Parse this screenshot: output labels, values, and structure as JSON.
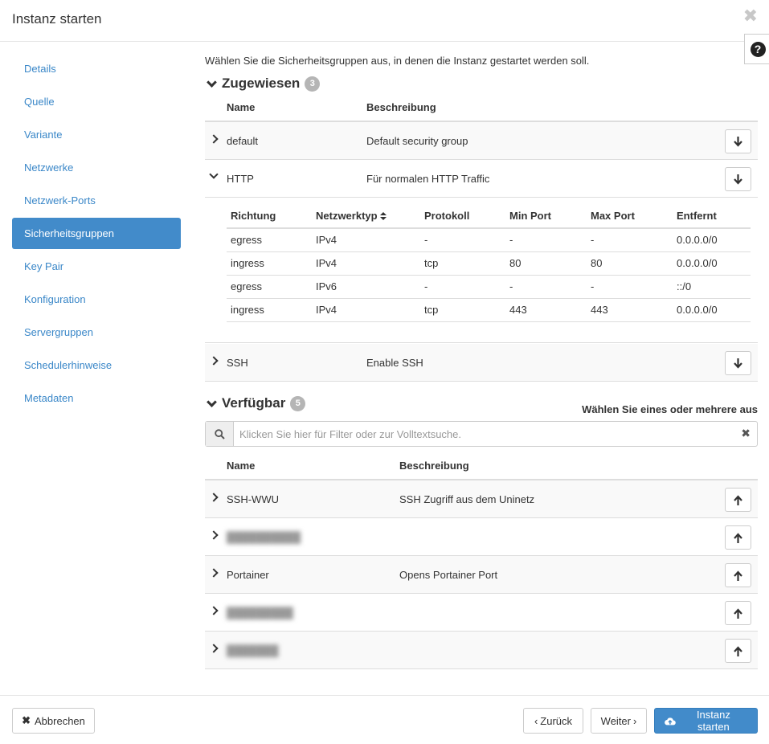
{
  "modal": {
    "title": "Instanz starten",
    "close_glyph": "✖",
    "help_glyph": "?"
  },
  "sidebar": {
    "items": [
      {
        "label": "Details",
        "active": false
      },
      {
        "label": "Quelle",
        "active": false
      },
      {
        "label": "Variante",
        "active": false
      },
      {
        "label": "Netzwerke",
        "active": false
      },
      {
        "label": "Netzwerk-Ports",
        "active": false
      },
      {
        "label": "Sicherheitsgruppen",
        "active": true
      },
      {
        "label": "Key Pair",
        "active": false
      },
      {
        "label": "Konfiguration",
        "active": false
      },
      {
        "label": "Servergruppen",
        "active": false
      },
      {
        "label": "Schedulerhinweise",
        "active": false
      },
      {
        "label": "Metadaten",
        "active": false
      }
    ]
  },
  "main": {
    "intro": "Wählen Sie die Sicherheitsgruppen aus, in denen die Instanz gestartet werden soll.",
    "allocated": {
      "title": "Zugewiesen",
      "count": "3",
      "col_name": "Name",
      "col_desc": "Beschreibung",
      "rows": [
        {
          "name": "default",
          "description": "Default security group",
          "expanded": false
        },
        {
          "name": "HTTP",
          "description": "Für normalen HTTP Traffic",
          "expanded": true
        },
        {
          "name": "SSH",
          "description": "Enable SSH",
          "expanded": false
        }
      ],
      "rules": {
        "headers": [
          "Richtung",
          "Netzwerktyp",
          "Protokoll",
          "Min Port",
          "Max Port",
          "Entfernt"
        ],
        "rows": [
          [
            "egress",
            "IPv4",
            "-",
            "-",
            "-",
            "0.0.0.0/0"
          ],
          [
            "ingress",
            "IPv4",
            "tcp",
            "80",
            "80",
            "0.0.0.0/0"
          ],
          [
            "egress",
            "IPv6",
            "-",
            "-",
            "-",
            "::/0"
          ],
          [
            "ingress",
            "IPv4",
            "tcp",
            "443",
            "443",
            "0.0.0.0/0"
          ]
        ]
      }
    },
    "available": {
      "title": "Verfügbar",
      "count": "5",
      "hint": "Wählen Sie eines oder mehrere aus",
      "search_placeholder": "Klicken Sie hier für Filter oder zur Volltextsuche.",
      "col_name": "Name",
      "col_desc": "Beschreibung",
      "rows": [
        {
          "name": "SSH-WWU",
          "description": "SSH Zugriff aus dem Uninetz",
          "blurred": false
        },
        {
          "name": "",
          "description": "",
          "blurred": true
        },
        {
          "name": "Portainer",
          "description": "Opens Portainer Port",
          "blurred": false
        },
        {
          "name": "",
          "description": "",
          "blurred": true
        },
        {
          "name": "",
          "description": "",
          "blurred": true
        }
      ]
    }
  },
  "footer": {
    "cancel_label": "Abbrechen",
    "back_label": "Zurück",
    "next_label": "Weiter",
    "launch_label": "Instanz starten"
  },
  "colors": {
    "accent": "#428bca",
    "link": "#3a87c8"
  }
}
